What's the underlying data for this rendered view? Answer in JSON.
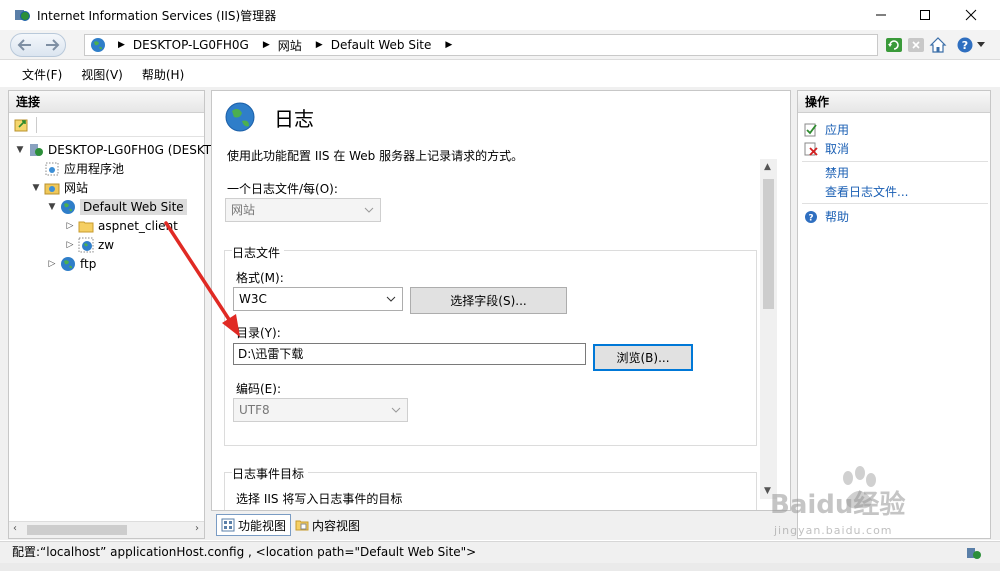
{
  "window": {
    "title": "Internet Information Services (IIS)管理器"
  },
  "address": {
    "crumbs": [
      "DESKTOP-LG0FH0G",
      "网站",
      "Default Web Site"
    ]
  },
  "menu": {
    "file": "文件(F)",
    "view": "视图(V)",
    "help": "帮助(H)"
  },
  "connections": {
    "header": "连接",
    "tree": {
      "server": "DESKTOP-LG0FH0G (DESKT",
      "app_pools": "应用程序池",
      "sites": "网站",
      "default_site": "Default Web Site",
      "aspnet_client": "aspnet_client",
      "zw": "zw",
      "ftp": "ftp"
    }
  },
  "main": {
    "title": "日志",
    "description": "使用此功能配置 IIS 在 Web 服务器上记录请求的方式。",
    "one_log_file_label": "一个日志文件/每(O):",
    "one_log_file_value": "网站",
    "log_file_group": "日志文件",
    "format_label": "格式(M):",
    "format_value": "W3C",
    "select_fields_button": "选择字段(S)...",
    "directory_label": "目录(Y):",
    "directory_value": "D:\\迅雷下载",
    "browse_button": "浏览(B)...",
    "encoding_label": "编码(E):",
    "encoding_value": "UTF8",
    "event_target_group": "日志事件目标",
    "event_target_desc": "选择 IIS 将写入日志事件的目标"
  },
  "view_tabs": {
    "features": "功能视图",
    "content": "内容视图"
  },
  "actions": {
    "header": "操作",
    "apply": "应用",
    "cancel": "取消",
    "disable": "禁用",
    "view_logs": "查看日志文件...",
    "help": "帮助"
  },
  "status": {
    "text": "配置:“localhost” applicationHost.config , <location path=\"Default Web Site\">"
  },
  "watermark": {
    "brand": "Baidu经验",
    "url": "jingyan.baidu.com"
  }
}
